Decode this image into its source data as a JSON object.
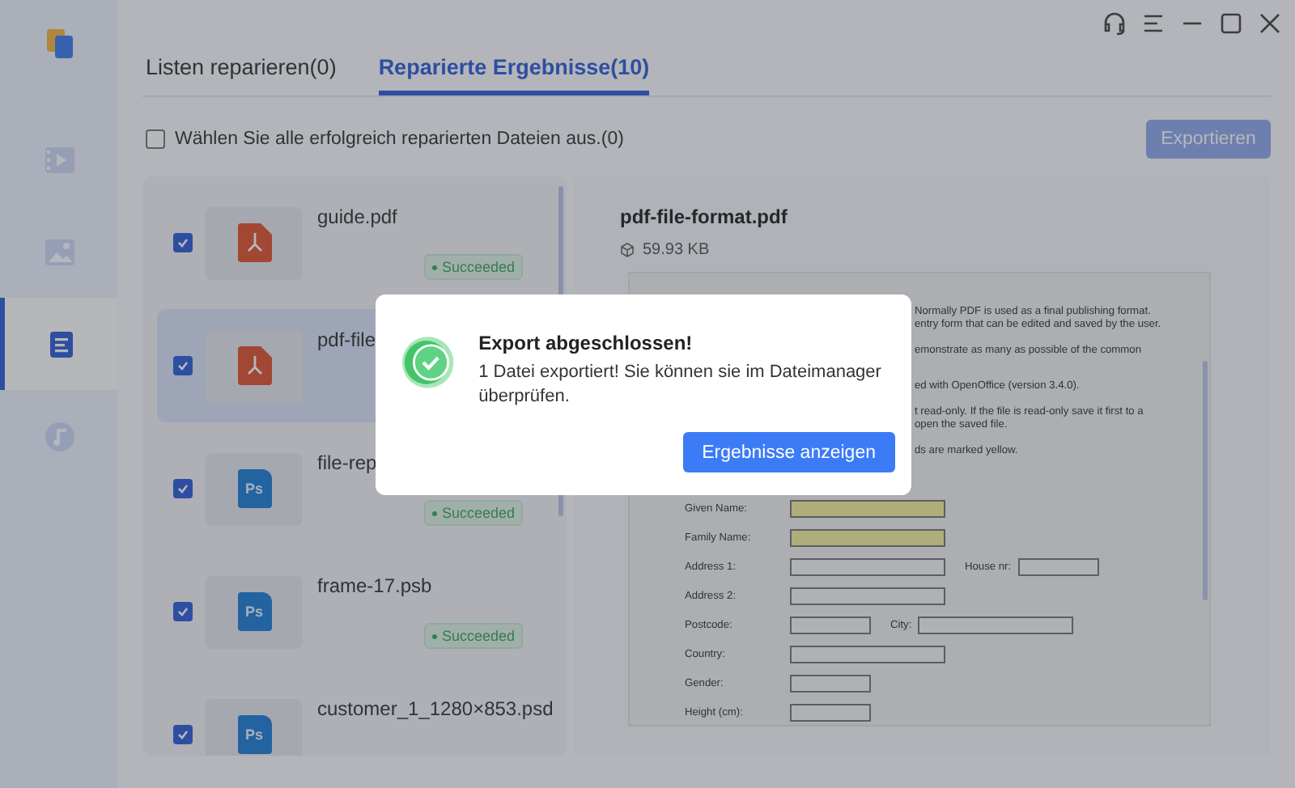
{
  "sidebar": {
    "items": [
      {
        "kind": "video",
        "selected": false
      },
      {
        "kind": "image",
        "selected": false
      },
      {
        "kind": "document",
        "selected": true
      },
      {
        "kind": "audio",
        "selected": false
      }
    ]
  },
  "tabs": [
    {
      "label": "Listen reparieren(0)",
      "selected": false
    },
    {
      "label": "Reparierte Ergebnisse(10)",
      "selected": true
    }
  ],
  "select_all": {
    "label": "Wählen Sie alle erfolgreich reparierten Dateien aus.(0)",
    "checked": false
  },
  "export_button": {
    "label": "Exportieren",
    "disabled": true
  },
  "files": [
    {
      "name": "guide.pdf",
      "kind": "pdf",
      "checked": true,
      "selected": false,
      "status": "Succeeded"
    },
    {
      "name": "pdf-file",
      "kind": "pdf",
      "checked": true,
      "selected": true
    },
    {
      "name": "file-rep",
      "kind": "ps",
      "icon_label": "Ps",
      "checked": true,
      "selected": false,
      "status": "Succeeded"
    },
    {
      "name": "frame-17.psb",
      "kind": "ps",
      "icon_label": "Ps",
      "checked": true,
      "selected": false,
      "status": "Succeeded"
    },
    {
      "name": "customer_1_1280×853.psd",
      "kind": "ps",
      "icon_label": "Ps",
      "checked": true,
      "selected": false
    }
  ],
  "preview": {
    "title": "pdf-file-format.pdf",
    "size": "59.93 KB",
    "document": {
      "text_lines": [
        "Normally PDF is used as a final publishing format.",
        "entry form that can be edited and saved by the user.",
        "emonstrate as many as possible of the common",
        "ed with OpenOffice (version 3.4.0).",
        "t read-only. If the file is read-only save it first to a",
        "open the saved file.",
        "ds are marked yellow."
      ],
      "form_rows": [
        {
          "label": "Given Name:",
          "fields": [
            {
              "kind": "wide",
              "required": true
            }
          ]
        },
        {
          "label": "Family Name:",
          "fields": [
            {
              "kind": "wide",
              "required": true
            }
          ]
        },
        {
          "label": "Address 1:",
          "fields": [
            {
              "kind": "wide",
              "required": false
            },
            {
              "kind": "short",
              "label": "House nr:",
              "required": false
            }
          ]
        },
        {
          "label": "Address 2:",
          "fields": [
            {
              "kind": "wide",
              "required": false
            }
          ]
        },
        {
          "label": "Postcode:",
          "fields": [
            {
              "kind": "short",
              "required": false
            },
            {
              "kind": "long",
              "label": "City:",
              "required": false
            }
          ]
        },
        {
          "label": "Country:",
          "fields": [
            {
              "kind": "wide",
              "required": false
            }
          ]
        },
        {
          "label": "Gender:",
          "fields": [
            {
              "kind": "short",
              "required": false
            }
          ]
        },
        {
          "label": "Height (cm):",
          "fields": [
            {
              "kind": "short",
              "required": false
            }
          ]
        }
      ]
    }
  },
  "dialog": {
    "title": "Export abgeschlossen!",
    "message": "1 Datei exportiert! Sie können sie im Dateimanager überprüfen.",
    "button": "Ergebnisse anzeigen"
  }
}
